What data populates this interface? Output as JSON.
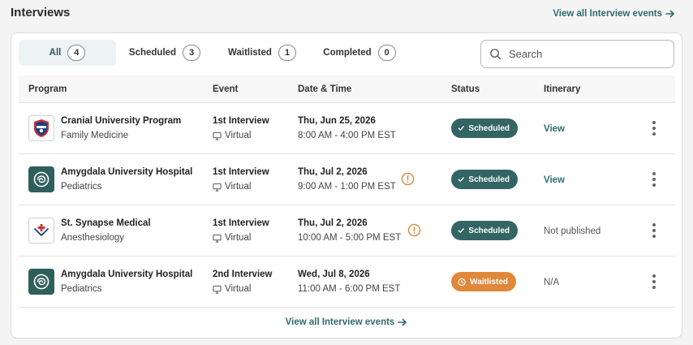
{
  "header": {
    "title": "Interviews",
    "view_all_label": "View all Interview events"
  },
  "tabs": [
    {
      "label": "All",
      "count": "4",
      "active": true
    },
    {
      "label": "Scheduled",
      "count": "3",
      "active": false
    },
    {
      "label": "Waitlisted",
      "count": "1",
      "active": false
    },
    {
      "label": "Completed",
      "count": "0",
      "active": false
    }
  ],
  "search": {
    "placeholder": "Search",
    "value": ""
  },
  "columns": {
    "program": "Program",
    "event": "Event",
    "datetime": "Date & Time",
    "status": "Status",
    "itinerary": "Itinerary"
  },
  "rows": [
    {
      "program": "Cranial University Program",
      "specialty": "Family Medicine",
      "logo": "shield-logo",
      "event": "1st Interview",
      "mode": "Virtual",
      "date": "Thu, Jun 25, 2026",
      "time": "8:00 AM - 4:00 PM EST",
      "warning": false,
      "status": "Scheduled",
      "itinerary": "View"
    },
    {
      "program": "Amygdala University Hospital",
      "specialty": "Pediatrics",
      "logo": "brain-logo",
      "event": "1st Interview",
      "mode": "Virtual",
      "date": "Thu, Jul 2, 2026",
      "time": "9:00 AM - 1:00 PM EST",
      "warning": true,
      "status": "Scheduled",
      "itinerary": "View"
    },
    {
      "program": "St. Synapse Medical",
      "specialty": "Anesthesiology",
      "logo": "cross-logo",
      "event": "1st Interview",
      "mode": "Virtual",
      "date": "Thu, Jul 2, 2026",
      "time": "10:00 AM - 5:00 PM EST",
      "warning": true,
      "status": "Scheduled",
      "itinerary": "Not published"
    },
    {
      "program": "Amygdala University Hospital",
      "specialty": "Pediatrics",
      "logo": "brain-logo",
      "event": "2nd Interview",
      "mode": "Virtual",
      "date": "Wed, Jul 8, 2026",
      "time": "11:00 AM - 6:00 PM EST",
      "warning": false,
      "status": "Waitlisted",
      "itinerary": "N/A"
    }
  ],
  "footer": {
    "view_all_label": "View all Interview events"
  },
  "colors": {
    "accent": "#2f6a6e",
    "scheduled": "#336564",
    "waitlisted": "#e0883a",
    "warning": "#e0883a"
  }
}
